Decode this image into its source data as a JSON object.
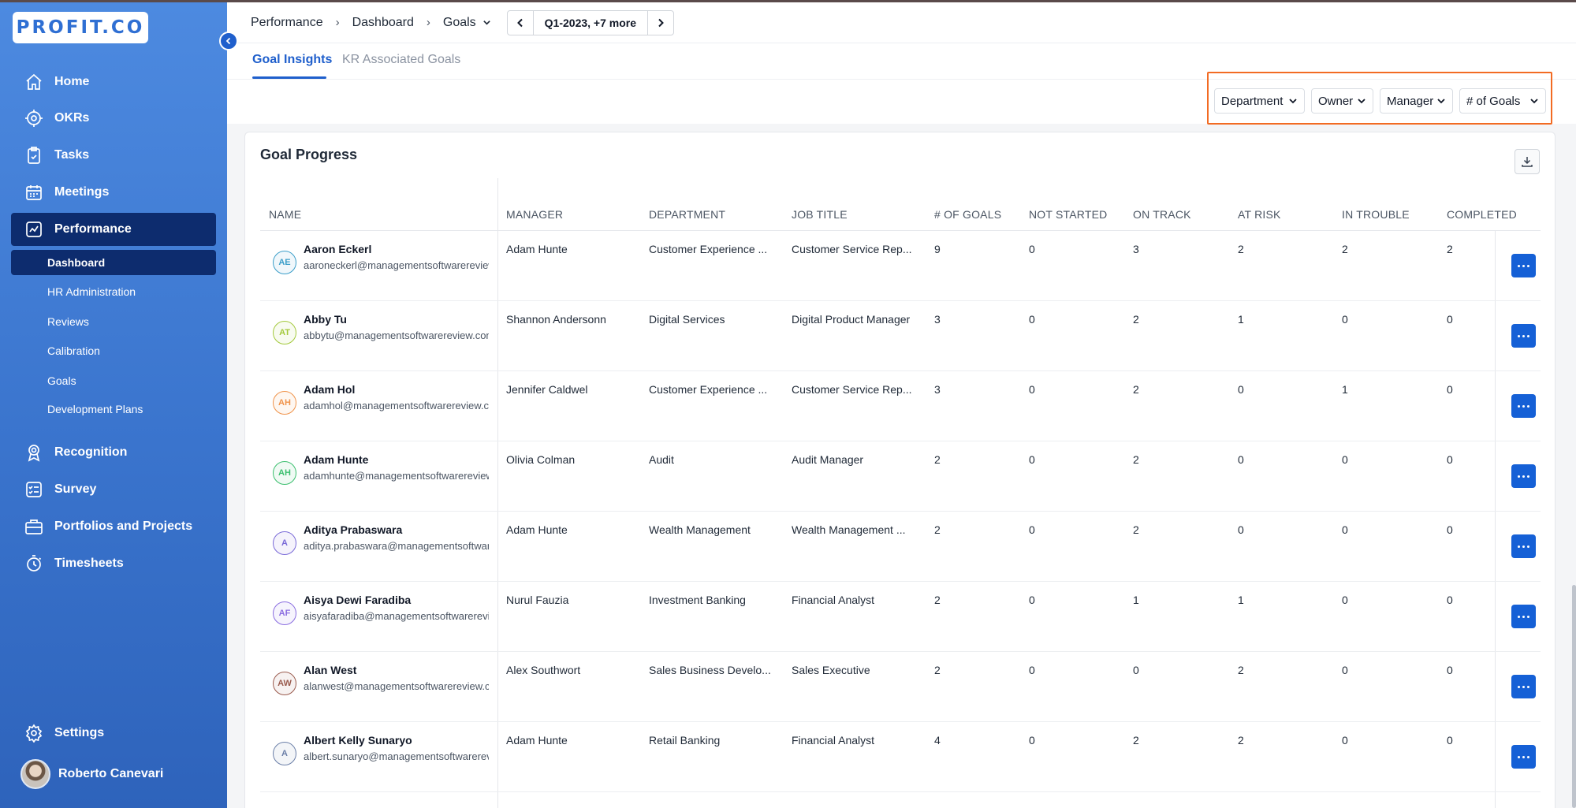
{
  "brand": {
    "logo_text": "PROFIT.CO"
  },
  "sidebar": {
    "items": [
      {
        "label": "Home",
        "icon": "home-icon"
      },
      {
        "label": "OKRs",
        "icon": "target-icon"
      },
      {
        "label": "Tasks",
        "icon": "clipboard-check-icon"
      },
      {
        "label": "Meetings",
        "icon": "calendar-icon"
      },
      {
        "label": "Performance",
        "icon": "performance-chart-icon"
      },
      {
        "label": "Recognition",
        "icon": "badge-icon"
      },
      {
        "label": "Survey",
        "icon": "checklist-icon"
      },
      {
        "label": "Portfolios and Projects",
        "icon": "briefcase-icon"
      },
      {
        "label": "Timesheets",
        "icon": "stopwatch-icon"
      }
    ],
    "performance_sub": [
      "Dashboard",
      "HR Administration",
      "Reviews",
      "Calibration",
      "Goals",
      "Development Plans"
    ],
    "settings": "Settings",
    "user_name": "Roberto Canevari"
  },
  "header": {
    "breadcrumb": [
      "Performance",
      "Dashboard",
      "Goals"
    ],
    "period": "Q1-2023, +7 more"
  },
  "tabs": [
    "Goal Insights",
    "KR Associated Goals"
  ],
  "filters": [
    "Department",
    "Owner",
    "Manager",
    "# of Goals"
  ],
  "card": {
    "title": "Goal Progress"
  },
  "table": {
    "columns": [
      "NAME",
      "MANAGER",
      "DEPARTMENT",
      "JOB TITLE",
      "# OF GOALS",
      "NOT STARTED",
      "ON TRACK",
      "AT RISK",
      "IN TROUBLE",
      "COMPLETED"
    ],
    "rows": [
      {
        "initials": "AE",
        "color": "#3b9ec9",
        "name": "Aaron Eckerl",
        "email": "aaroneckerl@managementsoftwarereview.com",
        "manager": "Adam Hunte",
        "department": "Customer Experience ...",
        "job": "Customer Service Rep...",
        "goals": "9",
        "not_started": "0",
        "on_track": "3",
        "at_risk": "2",
        "in_trouble": "2",
        "completed": "2"
      },
      {
        "initials": "AT",
        "color": "#a3c93b",
        "name": "Abby Tu",
        "email": "abbytu@managementsoftwarereview.com",
        "manager": "Shannon Andersonn",
        "department": "Digital Services",
        "job": "Digital Product Manager",
        "goals": "3",
        "not_started": "0",
        "on_track": "2",
        "at_risk": "1",
        "in_trouble": "0",
        "completed": "0"
      },
      {
        "initials": "AH",
        "color": "#f0934a",
        "name": "Adam Hol",
        "email": "adamhol@managementsoftwarereview.com",
        "manager": "Jennifer Caldwel",
        "department": "Customer Experience ...",
        "job": "Customer Service Rep...",
        "goals": "3",
        "not_started": "0",
        "on_track": "2",
        "at_risk": "0",
        "in_trouble": "1",
        "completed": "0"
      },
      {
        "initials": "AH",
        "color": "#3bbf6e",
        "name": "Adam Hunte",
        "email": "adamhunte@managementsoftwarereview.com",
        "manager": "Olivia Colman",
        "department": "Audit",
        "job": "Audit Manager",
        "goals": "2",
        "not_started": "0",
        "on_track": "2",
        "at_risk": "0",
        "in_trouble": "0",
        "completed": "0"
      },
      {
        "initials": "A",
        "color": "#7a6ad8",
        "name": "Aditya Prabaswara",
        "email": "aditya.prabaswara@managementsoftwarereview.com",
        "manager": "Adam Hunte",
        "department": "Wealth Management",
        "job": "Wealth Management ...",
        "goals": "2",
        "not_started": "0",
        "on_track": "2",
        "at_risk": "0",
        "in_trouble": "0",
        "completed": "0"
      },
      {
        "initials": "AF",
        "color": "#8a6de0",
        "name": "Aisya Dewi Faradiba",
        "email": "aisyafaradiba@managementsoftwarereview.com",
        "manager": "Nurul Fauzia",
        "department": "Investment Banking",
        "job": "Financial Analyst",
        "goals": "2",
        "not_started": "0",
        "on_track": "1",
        "at_risk": "1",
        "in_trouble": "0",
        "completed": "0"
      },
      {
        "initials": "AW",
        "color": "#9a5b4e",
        "name": "Alan West",
        "email": "alanwest@managementsoftwarereview.com",
        "manager": "Alex Southwort",
        "department": "Sales Business Develo...",
        "job": "Sales Executive",
        "goals": "2",
        "not_started": "0",
        "on_track": "0",
        "at_risk": "2",
        "in_trouble": "0",
        "completed": "0"
      },
      {
        "initials": "A",
        "color": "#6b7fa8",
        "name": "Albert Kelly Sunaryo",
        "email": "albert.sunaryo@managementsoftwarereview.com",
        "manager": "Adam Hunte",
        "department": "Retail Banking",
        "job": "Financial Analyst",
        "goals": "4",
        "not_started": "0",
        "on_track": "2",
        "at_risk": "2",
        "in_trouble": "0",
        "completed": "0"
      }
    ]
  },
  "colors": {
    "accent": "#1f5fcc",
    "highlight": "#f26b23",
    "sidebar_active": "#0d2c6e"
  }
}
